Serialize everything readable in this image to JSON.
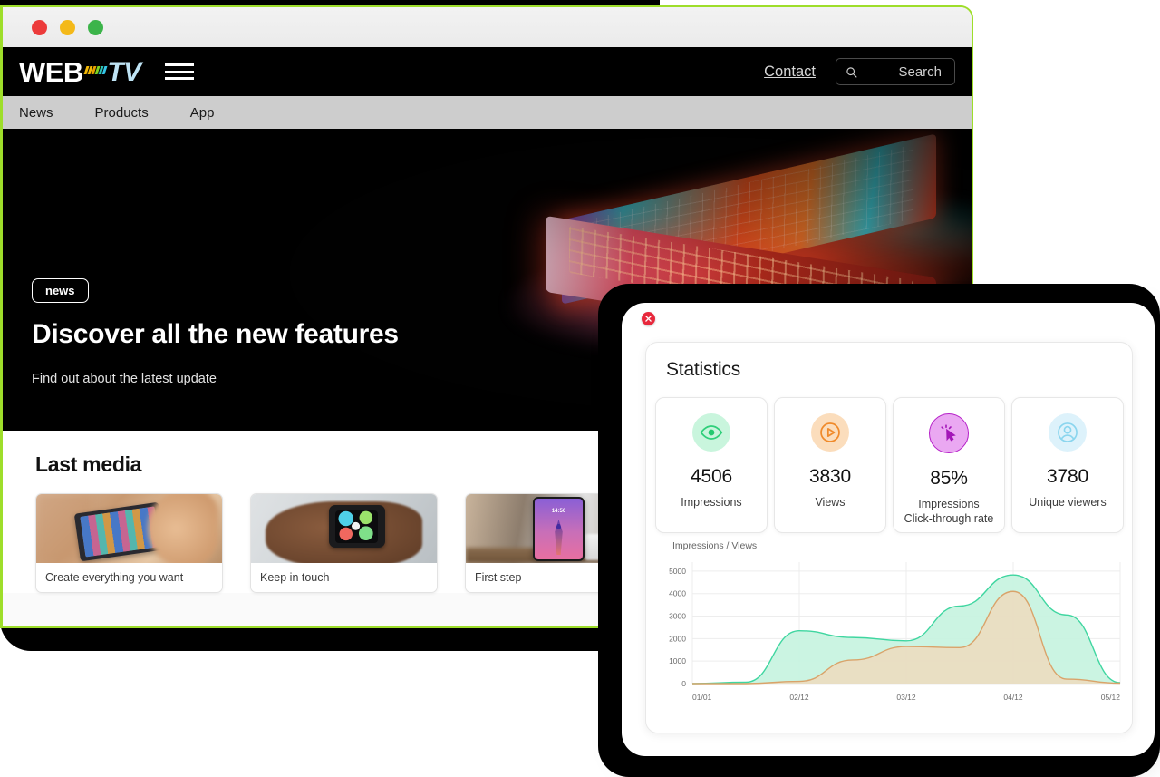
{
  "browser": {
    "traffic_lights": [
      "close",
      "minimize",
      "maximize"
    ]
  },
  "site": {
    "logo": {
      "web": "WEB",
      "tv": "TV",
      "dash_colors": [
        "#f2b705",
        "#f2b705",
        "#e8a100",
        "#7ed321",
        "#2ec4b6",
        "#35c7e8"
      ]
    },
    "header": {
      "contact_label": "Contact",
      "search_placeholder": "Search",
      "search_value": "",
      "menu_icon": "hamburger-icon",
      "search_icon": "search-icon"
    },
    "nav": [
      {
        "label": "News"
      },
      {
        "label": "Products"
      },
      {
        "label": "App"
      }
    ],
    "hero": {
      "badge": "news",
      "title": "Discover all the new features",
      "subtitle": "Find out about the latest update"
    },
    "last_media": {
      "heading": "Last media",
      "cards": [
        {
          "caption": "Create everything you want"
        },
        {
          "caption": "Keep in touch"
        },
        {
          "caption": "First step"
        }
      ]
    }
  },
  "statistics": {
    "close_icon": "close-icon",
    "title": "Statistics",
    "tiles": [
      {
        "icon": "eye-icon",
        "value": "4506",
        "label": "Impressions",
        "color": "#2fcf7a",
        "bg": "#c9f5dd"
      },
      {
        "icon": "play-icon",
        "value": "3830",
        "label": "Views",
        "color": "#f08a2a",
        "bg": "#fbddbc"
      },
      {
        "icon": "cursor-icon",
        "value": "85%",
        "label": "Impressions\nClick-through rate",
        "color": "#b51fc8",
        "bg": "#eaa8f2"
      },
      {
        "icon": "user-icon",
        "value": "3780",
        "label": "Unique viewers",
        "color": "#8ad5ee",
        "bg": "#ddf2fb"
      }
    ],
    "tile_labels": {
      "ctr_line1": "Impressions",
      "ctr_line2": "Click-through rate"
    }
  },
  "chart_data": {
    "type": "area",
    "title": "Impressions / Views",
    "xlabel": "",
    "ylabel": "",
    "grid": true,
    "legend_position": "top-left",
    "ylim": [
      0,
      5400
    ],
    "yticks": [
      0,
      1000,
      2000,
      3000,
      4000,
      5000
    ],
    "x_tick_labels": [
      "01/01",
      "02/12",
      "03/12",
      "04/12",
      "05/12"
    ],
    "x": [
      0,
      0.5,
      1,
      1.5,
      2,
      2.5,
      3,
      3.5,
      4
    ],
    "series": [
      {
        "name": "Impressions",
        "color": "#3fd6a0",
        "fill": "#c7f3e0",
        "values": [
          0,
          60,
          2350,
          2050,
          1900,
          3450,
          4830,
          3050,
          40
        ]
      },
      {
        "name": "Views",
        "color": "#d9a36a",
        "fill": "#ecdcc0",
        "values": [
          0,
          0,
          100,
          1050,
          1650,
          1600,
          4100,
          200,
          20
        ]
      }
    ]
  }
}
